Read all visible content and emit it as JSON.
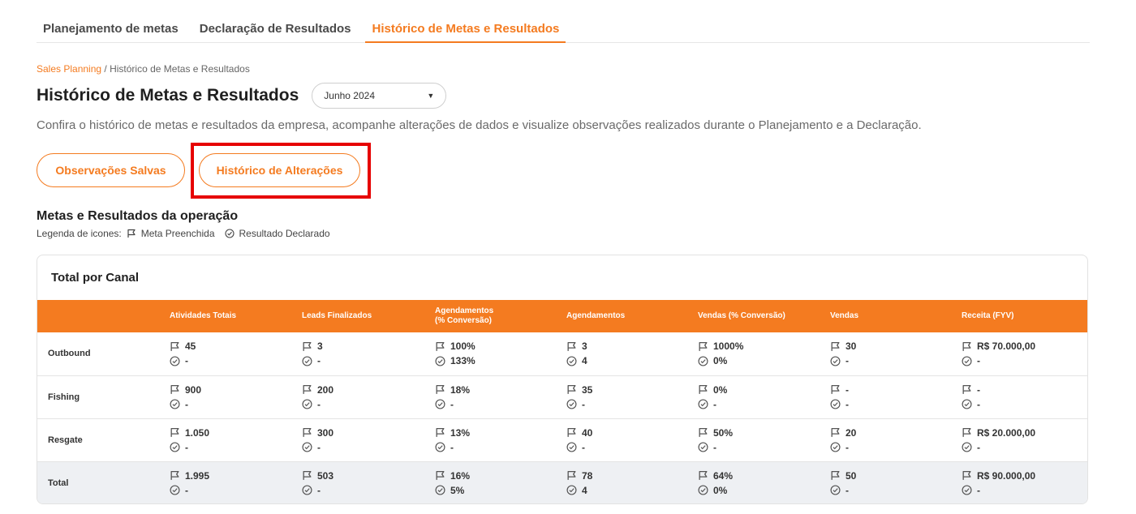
{
  "tabs": [
    {
      "label": "Planejamento de metas",
      "active": false
    },
    {
      "label": "Declaração de Resultados",
      "active": false
    },
    {
      "label": "Histórico de Metas e Resultados",
      "active": true
    }
  ],
  "breadcrumb": {
    "root": "Sales Planning",
    "separator": " / ",
    "current": "Histórico de Metas e Resultados"
  },
  "page": {
    "title": "Histórico de Metas e Resultados",
    "month_select": "Junho 2024",
    "description": "Confira o histórico de metas e resultados da empresa, acompanhe alterações de dados e visualize observações realizados durante o Planejamento e a Declaração."
  },
  "buttons": {
    "observacoes": "Observações Salvas",
    "historico": "Histórico de Alterações"
  },
  "section": {
    "title": "Metas e Resultados da operação",
    "legend_label": "Legenda de icones:",
    "legend_meta": "Meta Preenchida",
    "legend_resultado": "Resultado Declarado"
  },
  "card": {
    "title": "Total por Canal"
  },
  "table": {
    "headers": [
      "",
      "Atividades Totais",
      "Leads Finalizados",
      "Agendamentos\n(% Conversão)",
      "Agendamentos",
      "Vendas (% Conversão)",
      "Vendas",
      "Receita (FYV)"
    ],
    "rows": [
      {
        "label": "Outbound",
        "cells": [
          [
            "45",
            "-"
          ],
          [
            "3",
            "-"
          ],
          [
            "100%",
            "133%"
          ],
          [
            "3",
            "4"
          ],
          [
            "1000%",
            "0%"
          ],
          [
            "30",
            "-"
          ],
          [
            "R$ 70.000,00",
            "-"
          ]
        ]
      },
      {
        "label": "Fishing",
        "cells": [
          [
            "900",
            "-"
          ],
          [
            "200",
            "-"
          ],
          [
            "18%",
            "-"
          ],
          [
            "35",
            "-"
          ],
          [
            "0%",
            "-"
          ],
          [
            "-",
            "-"
          ],
          [
            "-",
            "-"
          ]
        ]
      },
      {
        "label": "Resgate",
        "cells": [
          [
            "1.050",
            "-"
          ],
          [
            "300",
            "-"
          ],
          [
            "13%",
            "-"
          ],
          [
            "40",
            "-"
          ],
          [
            "50%",
            "-"
          ],
          [
            "20",
            "-"
          ],
          [
            "R$ 20.000,00",
            "-"
          ]
        ]
      },
      {
        "label": "Total",
        "total": true,
        "cells": [
          [
            "1.995",
            "-"
          ],
          [
            "503",
            "-"
          ],
          [
            "16%",
            "5%"
          ],
          [
            "78",
            "4"
          ],
          [
            "64%",
            "0%"
          ],
          [
            "50",
            "-"
          ],
          [
            "R$ 90.000,00",
            "-"
          ]
        ]
      }
    ]
  },
  "colors": {
    "accent": "#f47b20",
    "highlight": "#e60000",
    "total_row_bg": "#eef0f3"
  }
}
